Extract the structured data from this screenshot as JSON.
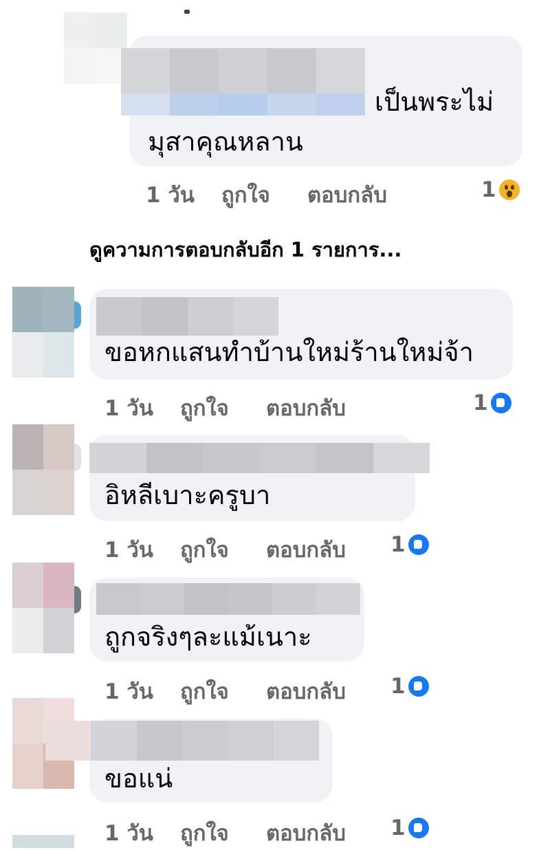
{
  "reply_top": {
    "text_line1": "เป็นพระไม่",
    "text_line2": "มุสาคุณหลาน",
    "time": "1 วัน",
    "like": "ถูกใจ",
    "reply": "ตอบกลับ",
    "reaction_count": "1",
    "reaction_icon": "wow-icon"
  },
  "more_replies": "ดูความการตอบกลับอีก 1 รายการ...",
  "comments": [
    {
      "text": "ขอหกแสนทำบ้านใหม่ร้านใหม่จ้า",
      "time": "1 วัน",
      "like": "ถูกใจ",
      "reply": "ตอบกลับ",
      "reaction_count": "1",
      "reaction_icon": "like-icon"
    },
    {
      "text": "อิหลีเบาะครูบา",
      "time": "1 วัน",
      "like": "ถูกใจ",
      "reply": "ตอบกลับ",
      "reaction_count": "1",
      "reaction_icon": "like-icon"
    },
    {
      "text": "ถูกจริงๆละแม้เนาะ",
      "time": "1 วัน",
      "like": "ถูกใจ",
      "reply": "ตอบกลับ",
      "reaction_count": "1",
      "reaction_icon": "like-icon"
    },
    {
      "text": "ขอแน่",
      "time": "1 วัน",
      "like": "ถูกใจ",
      "reply": "ตอบกลับ",
      "reaction_count": "1",
      "reaction_icon": "like-icon"
    }
  ],
  "colors": {
    "bubble": "#f0f2f5",
    "meta_text": "#65676b",
    "like_blue": "#1877f2",
    "wow_yellow": "#f7b125"
  }
}
